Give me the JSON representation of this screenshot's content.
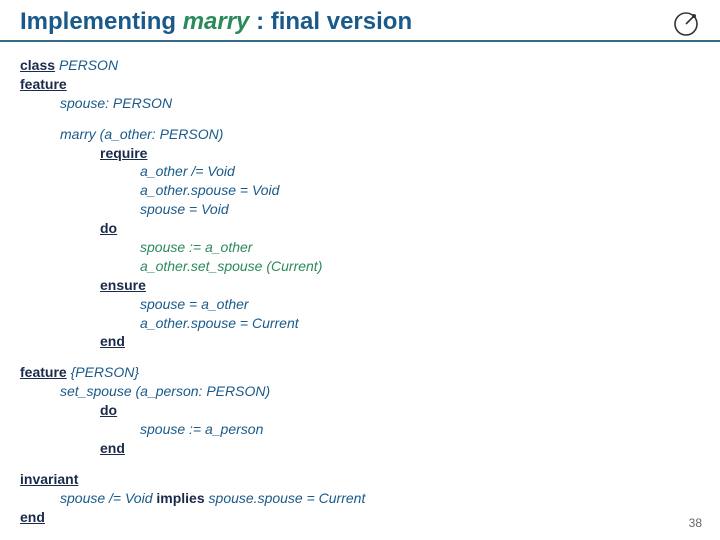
{
  "title": {
    "pre": "Implementing ",
    "em": "marry",
    "post": " : final version"
  },
  "code": {
    "kw": {
      "class": "class",
      "feature": "feature",
      "require": "require",
      "do": "do",
      "ensure": "ensure",
      "end": "end",
      "invariant": "invariant",
      "implies": "implies"
    },
    "l1": "PERSON",
    "l3": "spouse: PERSON",
    "l4": "marry (a_other: PERSON)",
    "l6": "a_other /= Void",
    "l7": "a_other.spouse = Void",
    "l8": "spouse = Void",
    "l10": "spouse := a_other",
    "l11": "a_other.set_spouse (Current)",
    "l13": "spouse = a_other",
    "l14": "a_other.spouse = Current",
    "l16_vis": "{PERSON}",
    "l17": "set_spouse (a_person: PERSON)",
    "l19": "spouse := a_person",
    "l22a": "spouse /= Void ",
    "l22b": " spouse.spouse = Current"
  },
  "page_number": "38"
}
